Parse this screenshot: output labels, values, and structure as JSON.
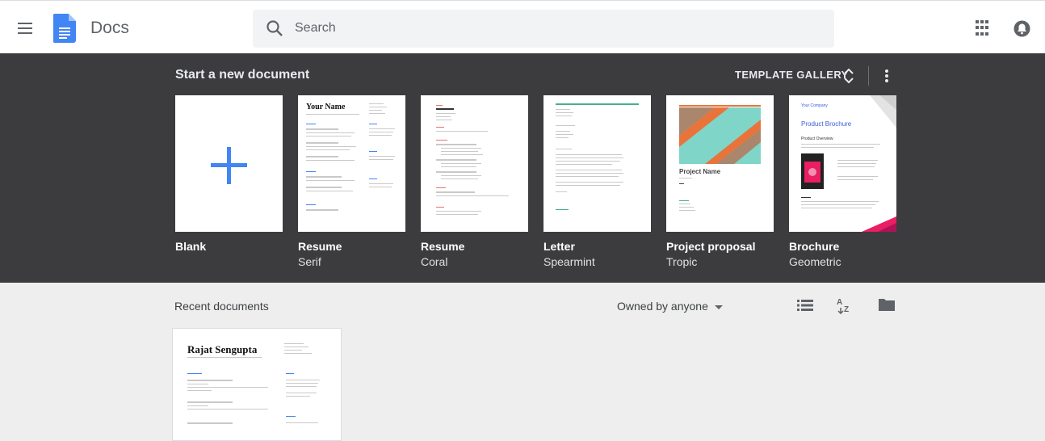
{
  "header": {
    "app_title": "Docs",
    "search_placeholder": "Search",
    "icons": [
      "menu-icon",
      "docs-logo-icon",
      "search-icon",
      "apps-grid-icon",
      "account-icon"
    ]
  },
  "new_document": {
    "title": "Start a new document",
    "gallery_label": "TEMPLATE GALLERY",
    "templates": [
      {
        "name": "Blank",
        "sub": ""
      },
      {
        "name": "Resume",
        "sub": "Serif"
      },
      {
        "name": "Resume",
        "sub": "Coral"
      },
      {
        "name": "Letter",
        "sub": "Spearmint"
      },
      {
        "name": "Project proposal",
        "sub": "Tropic"
      },
      {
        "name": "Brochure",
        "sub": "Geometric"
      }
    ],
    "thumb_text": {
      "serif_name": "Your Name",
      "coral_name": "Hello",
      "coral_name2": "I'm Your Name",
      "proposal_title": "Project Name",
      "brochure_company": "Your Company",
      "brochure_title": "Product Brochure",
      "brochure_overview": "Product Overview"
    }
  },
  "recent": {
    "title": "Recent documents",
    "owner_filter": "Owned by anyone",
    "documents": [
      {
        "name": "Rajat Sengupta"
      }
    ]
  },
  "colors": {
    "band_bg": "#3c3c3f",
    "blue_plus": "#4285f4",
    "coral": "#e57373",
    "spearmint": "#45b08c",
    "tropic_teal": "#7fd6c8",
    "tropic_orange": "#e8743b",
    "brochure_pink": "#e91e63"
  }
}
